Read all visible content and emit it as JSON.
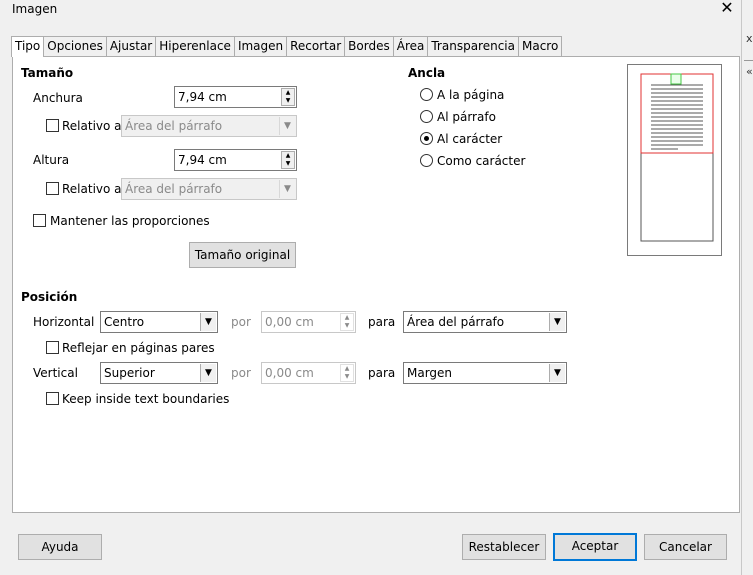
{
  "window": {
    "title": "Imagen",
    "close_glyph": "✕"
  },
  "edge": {
    "x_glyph": "x",
    "gl_glyph": "«"
  },
  "tabs": [
    {
      "label": "Tipo"
    },
    {
      "label": "Opciones"
    },
    {
      "label": "Ajustar"
    },
    {
      "label": "Hiperenlace"
    },
    {
      "label": "Imagen"
    },
    {
      "label": "Recortar"
    },
    {
      "label": "Bordes"
    },
    {
      "label": "Área"
    },
    {
      "label": "Transparencia"
    },
    {
      "label": "Macro"
    }
  ],
  "size": {
    "heading": "Tamaño",
    "width_label": "Anchura",
    "width_value": "7,94 cm",
    "width_relative_label": "Relativo a",
    "width_relative_value": "Área del párrafo",
    "height_label": "Altura",
    "height_value": "7,94 cm",
    "height_relative_label": "Relativo a",
    "height_relative_value": "Área del párrafo",
    "keep_ratio_label": "Mantener las proporciones",
    "original_size_button": "Tamaño original"
  },
  "anchor": {
    "heading": "Ancla",
    "options": [
      {
        "label": "A la página",
        "selected": false
      },
      {
        "label": "Al párrafo",
        "selected": false
      },
      {
        "label": "Al carácter",
        "selected": true
      },
      {
        "label": "Como carácter",
        "selected": false
      }
    ]
  },
  "position": {
    "heading": "Posición",
    "horizontal_label": "Horizontal",
    "horizontal_value": "Centro",
    "by_label": "por",
    "horizontal_by_value": "0,00 cm",
    "to_label": "para",
    "horizontal_to_value": "Área del párrafo",
    "mirror_label": "Reflejar en páginas pares",
    "vertical_label": "Vertical",
    "vertical_value": "Superior",
    "vertical_by_value": "0,00 cm",
    "vertical_to_value": "Margen",
    "keep_inside_label": "Keep inside text boundaries"
  },
  "footer": {
    "help": "Ayuda",
    "reset": "Restablecer",
    "ok": "Aceptar",
    "cancel": "Cancelar"
  },
  "colors": {
    "accent": "#0078d7",
    "preview_frame": "#e03030",
    "preview_anchor": "#46c846"
  }
}
